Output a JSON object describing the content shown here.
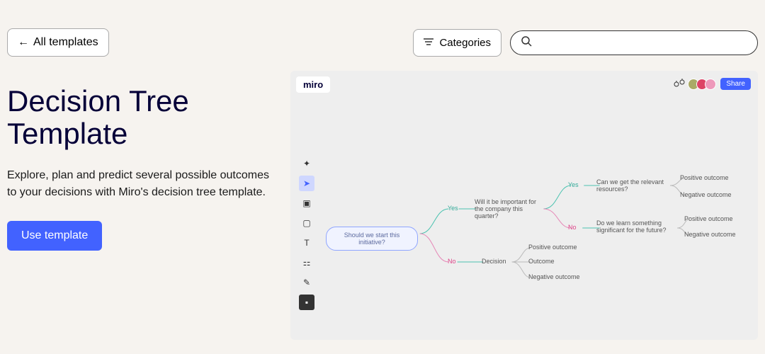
{
  "topbar": {
    "back_label": "All templates",
    "categories_label": "Categories",
    "search_placeholder": ""
  },
  "page": {
    "title": "Decision Tree Template",
    "description": "Explore, plan and predict several possible outcomes to your decisions with Miro's decision tree template.",
    "use_button": "Use template"
  },
  "preview": {
    "logo": "miro",
    "share_label": "Share",
    "diagram": {
      "root": "Should we start this initiative?",
      "yes": "Yes",
      "no": "No",
      "q_company": "Will it be important for the company this quarter?",
      "decision": "Decision",
      "q_resources": "Can we get the relevant resources?",
      "q_learn": "Do we learn something significant for the future?",
      "positive": "Positive outcome",
      "outcome": "Outcome",
      "negative": "Negative outcome"
    }
  }
}
